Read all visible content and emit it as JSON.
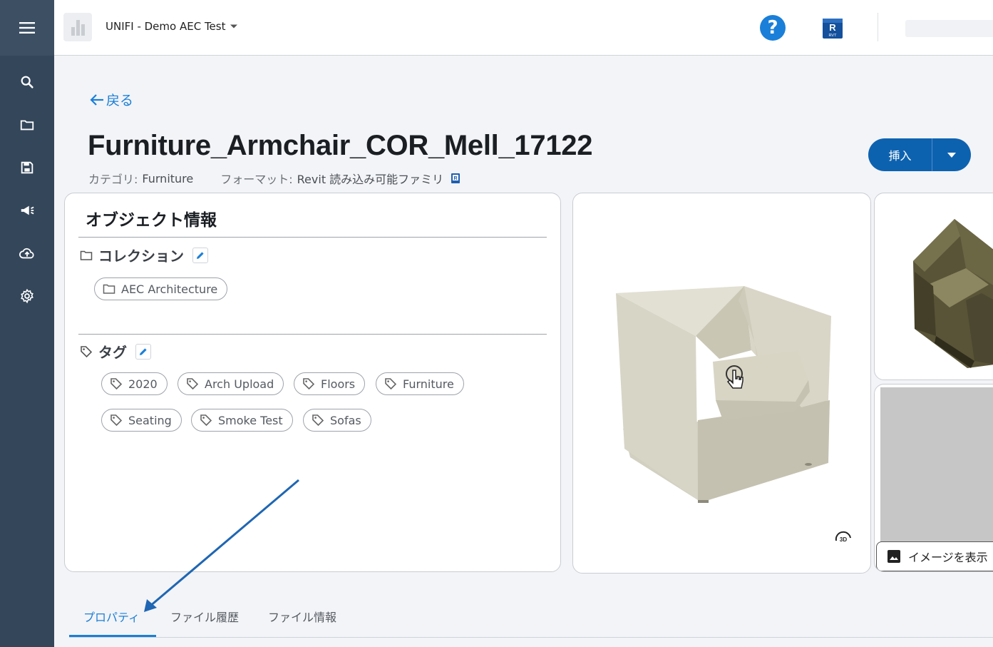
{
  "header": {
    "project_name": "UNIFI - Demo AEC Test",
    "help_glyph": "?",
    "revit_badge": "R",
    "revit_badge_sub": "RVT"
  },
  "sidebar": {
    "items": [
      {
        "icon": "menu-icon"
      },
      {
        "icon": "search-icon"
      },
      {
        "icon": "folder-icon"
      },
      {
        "icon": "save-icon"
      },
      {
        "icon": "megaphone-icon"
      },
      {
        "icon": "cloud-upload-icon"
      },
      {
        "icon": "gear-icon"
      }
    ]
  },
  "nav": {
    "back_label": "戻る"
  },
  "object": {
    "title": "Furniture_Armchair_COR_Mell_17122",
    "category_label": "カテゴリ:",
    "category_value": "Furniture",
    "format_label": "フォーマット:",
    "format_value": "Revit 読み込み可能ファミリ"
  },
  "actions": {
    "insert_label": "挿入"
  },
  "info": {
    "title": "オブジェクト情報",
    "collection_label": "コレクション",
    "collections": [
      "AEC Architecture"
    ],
    "tags_label": "タグ",
    "tags": [
      "2020",
      "Arch Upload",
      "Floors",
      "Furniture",
      "Seating",
      "Smoke Test",
      "Sofas"
    ]
  },
  "viewer": {
    "rotate_label": "3D",
    "show_image_label": "イメージを表示"
  },
  "tabs": [
    {
      "label": "プロパティ",
      "active": true
    },
    {
      "label": "ファイル履歴",
      "active": false
    },
    {
      "label": "ファイル情報",
      "active": false
    }
  ],
  "colors": {
    "accent": "#1a7fd8",
    "primary_button": "#0d62b0",
    "sidebar": "#34465a"
  }
}
